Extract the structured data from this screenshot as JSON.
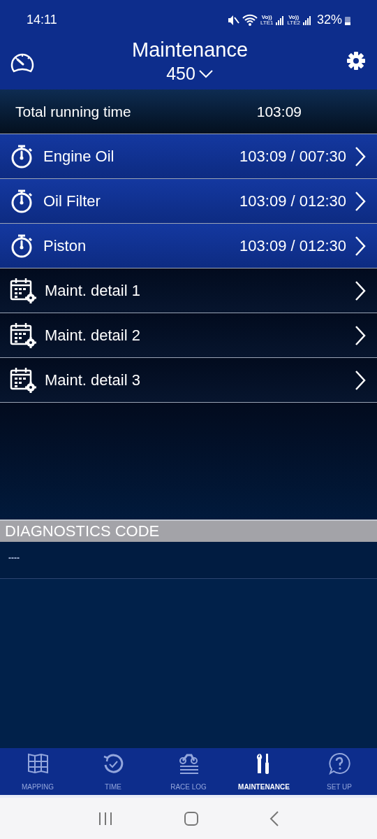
{
  "status_bar": {
    "time": "14:11",
    "volte_1": "Vo))",
    "network_1": "LTE1",
    "volte_2": "Vo))",
    "network_2": "LTE2",
    "battery": "32%"
  },
  "header": {
    "title": "Maintenance",
    "model": "450"
  },
  "total": {
    "label": "Total running time",
    "value": "103:09"
  },
  "items": [
    {
      "kind": "timer",
      "label": "Engine Oil",
      "value": "103:09 / 007:30"
    },
    {
      "kind": "timer",
      "label": "Oil Filter",
      "value": "103:09 / 012:30"
    },
    {
      "kind": "timer",
      "label": "Piston",
      "value": "103:09 / 012:30"
    },
    {
      "kind": "schedule",
      "label": "Maint. detail 1"
    },
    {
      "kind": "schedule",
      "label": "Maint. detail 2"
    },
    {
      "kind": "schedule",
      "label": "Maint. detail 3"
    }
  ],
  "diagnostics": {
    "title": "DIAGNOSTICS CODE",
    "code": "----"
  },
  "tabs": [
    {
      "kind": "map",
      "label": "MAPPING",
      "selected": false
    },
    {
      "kind": "time",
      "label": "TIME",
      "selected": false
    },
    {
      "kind": "racelog",
      "label": "RACE LOG",
      "selected": false
    },
    {
      "kind": "tools",
      "label": "MAINTENANCE",
      "selected": true
    },
    {
      "kind": "help",
      "label": "SET UP",
      "selected": false
    }
  ]
}
